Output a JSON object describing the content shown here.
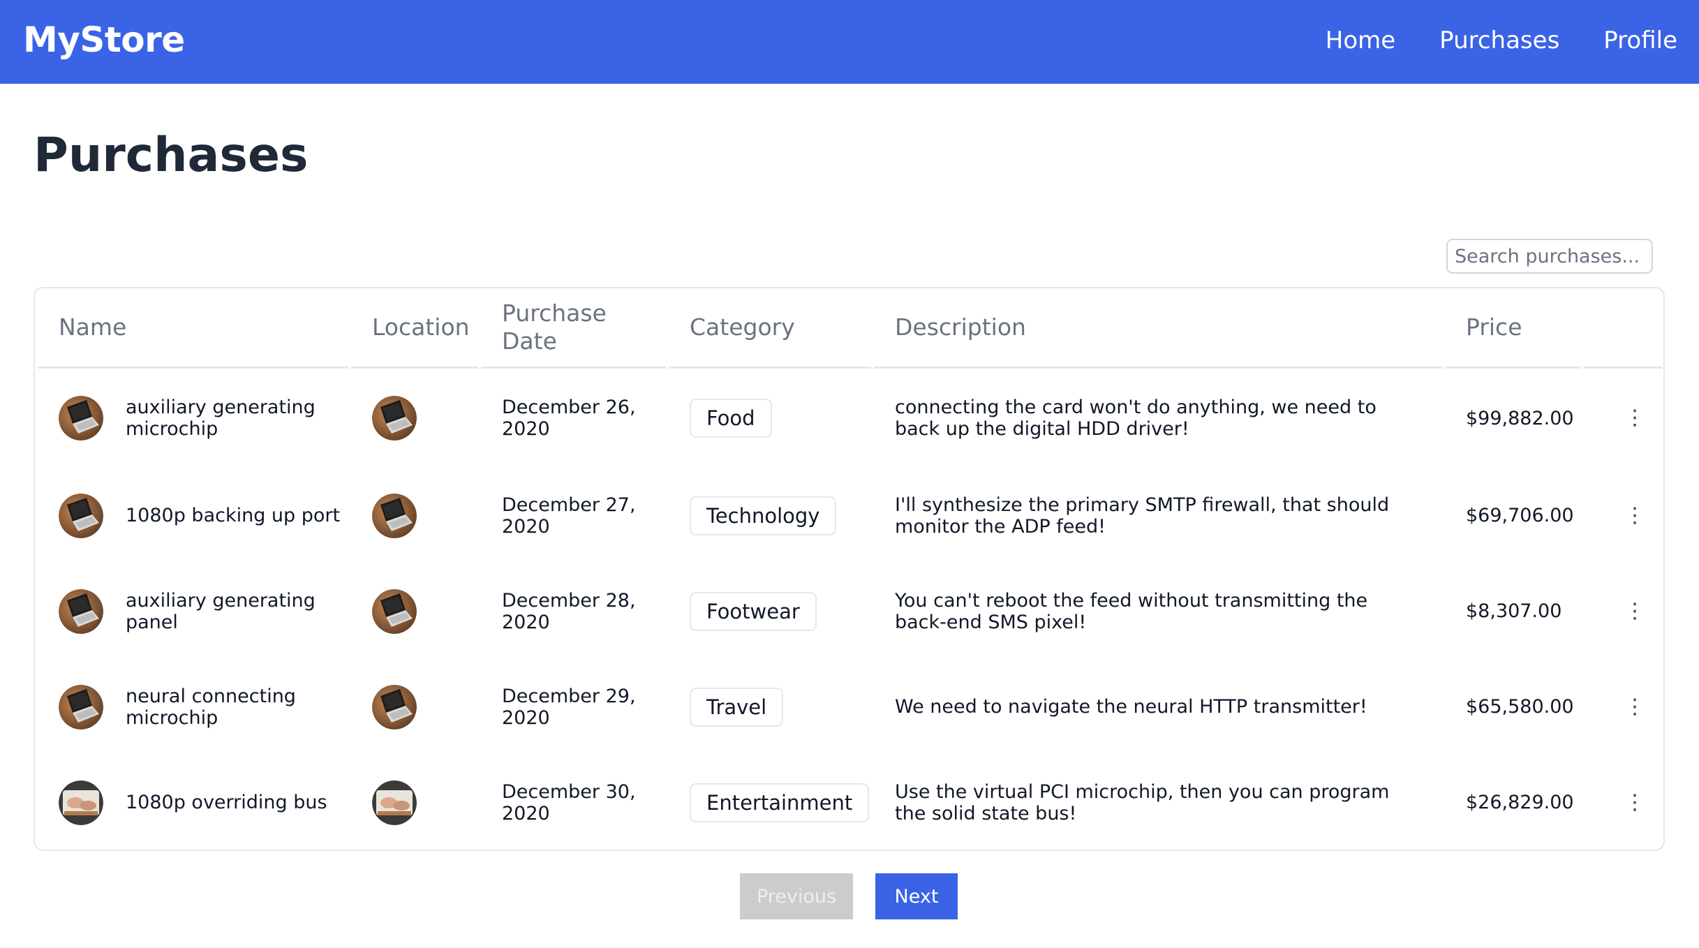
{
  "header": {
    "brand": "MyStore",
    "nav": [
      "Home",
      "Purchases",
      "Profile"
    ],
    "color": "#3b63e6"
  },
  "page": {
    "title": "Purchases"
  },
  "search": {
    "placeholder": "Search purchases..."
  },
  "table": {
    "columns": [
      "Name",
      "Location",
      "Purchase Date",
      "Category",
      "Description",
      "Price"
    ],
    "rows": [
      {
        "name": "auxiliary generating microchip",
        "date": "December 26, 2020",
        "category": "Food",
        "description": "connecting the card won't do anything, we need to back up the digital HDD driver!",
        "price": "$99,882.00",
        "image": "laptop-image"
      },
      {
        "name": "1080p backing up port",
        "date": "December 27, 2020",
        "category": "Technology",
        "description": "I'll synthesize the primary SMTP firewall, that should monitor the ADP feed!",
        "price": "$69,706.00",
        "image": "laptop-image"
      },
      {
        "name": "auxiliary generating panel",
        "date": "December 28, 2020",
        "category": "Footwear",
        "description": "You can't reboot the feed without transmitting the back-end SMS pixel!",
        "price": "$8,307.00",
        "image": "laptop-image"
      },
      {
        "name": "neural connecting microchip",
        "date": "December 29, 2020",
        "category": "Travel",
        "description": "We need to navigate the neural HTTP transmitter!",
        "price": "$65,580.00",
        "image": "laptop-image"
      },
      {
        "name": "1080p overriding bus",
        "date": "December 30, 2020",
        "category": "Entertainment",
        "description": "Use the virtual PCI microchip, then you can program the solid state bus!",
        "price": "$26,829.00",
        "image": "hands-image"
      }
    ],
    "row_menu_icon": "kebab-menu-icon"
  },
  "pagination": {
    "previous": "Previous",
    "next": "Next"
  }
}
